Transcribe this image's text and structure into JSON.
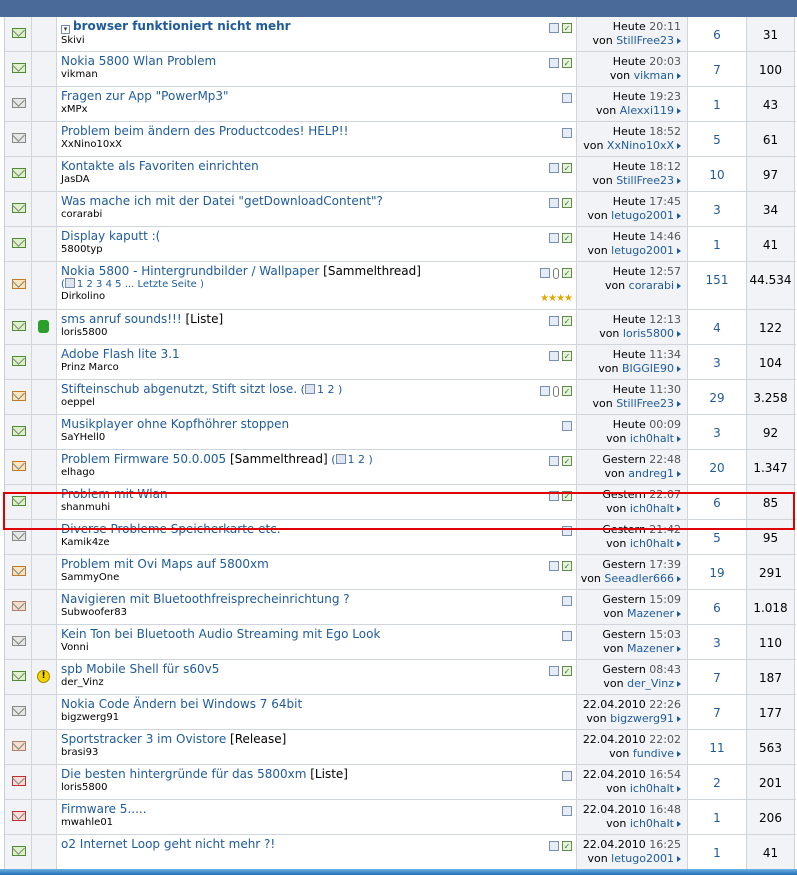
{
  "colors": {
    "link": "#1f5b9b",
    "highlight": "#e00000",
    "header": "#4a6a9a"
  },
  "threads": [
    {
      "icon": "envelope-new",
      "post_icon": "",
      "title": "browser funktioniert nicht mehr",
      "bold": true,
      "tag": "",
      "pages": [],
      "author": "Skivi",
      "date": "Heute",
      "time": "20:11",
      "by": "StillFree23",
      "replies": "6",
      "views": "31",
      "ticons": [
        "attach",
        "check"
      ],
      "has_dropdown": true
    },
    {
      "icon": "envelope-new",
      "post_icon": "",
      "title": "Nokia 5800 Wlan Problem",
      "bold": false,
      "tag": "",
      "pages": [],
      "author": "vikman",
      "date": "Heute",
      "time": "20:03",
      "by": "vikman",
      "replies": "7",
      "views": "100",
      "ticons": [
        "attach",
        "check"
      ]
    },
    {
      "icon": "envelope-grey",
      "post_icon": "",
      "title": "Fragen zur App \"PowerMp3\"",
      "bold": false,
      "tag": "",
      "pages": [],
      "author": "xMPx",
      "date": "Heute",
      "time": "19:23",
      "by": "Alexxi119",
      "replies": "1",
      "views": "43",
      "ticons": [
        "attach"
      ]
    },
    {
      "icon": "envelope-grey",
      "post_icon": "",
      "title": "Problem beim ändern des Productcodes! HELP!!",
      "bold": false,
      "tag": "",
      "pages": [],
      "author": "XxNino10xX",
      "date": "Heute",
      "time": "18:52",
      "by": "XxNino10xX",
      "replies": "5",
      "views": "61",
      "ticons": [
        "attach"
      ]
    },
    {
      "icon": "envelope-new",
      "post_icon": "",
      "title": "Kontakte als Favoriten einrichten",
      "bold": false,
      "tag": "",
      "pages": [],
      "author": "JasDA",
      "date": "Heute",
      "time": "18:12",
      "by": "StillFree23",
      "replies": "10",
      "views": "97",
      "ticons": [
        "attach",
        "check"
      ]
    },
    {
      "icon": "envelope-new",
      "post_icon": "",
      "title": "Was mache ich mit der Datei \"getDownloadContent\"?",
      "bold": false,
      "tag": "",
      "pages": [],
      "author": "corarabi",
      "date": "Heute",
      "time": "17:45",
      "by": "letugo2001",
      "replies": "3",
      "views": "34",
      "ticons": [
        "attach",
        "check"
      ]
    },
    {
      "icon": "envelope-new",
      "post_icon": "",
      "title": "Display kaputt :(",
      "bold": false,
      "tag": "",
      "pages": [],
      "author": "5800typ",
      "date": "Heute",
      "time": "14:46",
      "by": "letugo2001",
      "replies": "1",
      "views": "41",
      "ticons": [
        "attach",
        "check"
      ]
    },
    {
      "icon": "envelope-hot",
      "post_icon": "",
      "title": "Nokia 5800 - Hintergrundbilder / Wallpaper",
      "bold": false,
      "tag": "[Sammelthread]",
      "pages": [
        "1",
        "2",
        "3",
        "4",
        "5",
        "...",
        "Letzte Seite"
      ],
      "author": "Dirkolino",
      "date": "Heute",
      "time": "12:57",
      "by": "corarabi",
      "replies": "151",
      "views": "44.534",
      "ticons": [
        "attach",
        "clip",
        "check"
      ],
      "stars": "★★★★",
      "tall": true
    },
    {
      "icon": "envelope-new",
      "post_icon": "thumb",
      "title": "sms anruf sounds!!!",
      "bold": false,
      "tag": "[Liste]",
      "pages": [],
      "author": "loris5800",
      "date": "Heute",
      "time": "12:13",
      "by": "loris5800",
      "replies": "4",
      "views": "122",
      "ticons": [
        "attach",
        "check"
      ]
    },
    {
      "icon": "envelope-new",
      "post_icon": "",
      "title": "Adobe Flash lite 3.1",
      "bold": false,
      "tag": "",
      "pages": [],
      "author": "Prinz Marco",
      "date": "Heute",
      "time": "11:34",
      "by": "BIGGIE90",
      "replies": "3",
      "views": "104",
      "ticons": [
        "attach",
        "check"
      ]
    },
    {
      "icon": "envelope-hot",
      "post_icon": "",
      "title": "Stifteinschub abgenutzt, Stift sitzt lose.",
      "bold": false,
      "tag": "",
      "pages": [
        "1",
        "2"
      ],
      "author": "oeppel",
      "date": "Heute",
      "time": "11:30",
      "by": "StillFree23",
      "replies": "29",
      "views": "3.258",
      "ticons": [
        "attach",
        "clip",
        "check"
      ],
      "inline_pages": true
    },
    {
      "icon": "envelope-new",
      "post_icon": "",
      "title": "Musikplayer ohne Kopfhöhrer stoppen",
      "bold": false,
      "tag": "",
      "pages": [],
      "author": "SaYHell0",
      "date": "Heute",
      "time": "00:09",
      "by": "ich0halt",
      "replies": "3",
      "views": "92",
      "ticons": [
        "attach"
      ]
    },
    {
      "icon": "envelope-hot",
      "post_icon": "",
      "title": "Problem Firmware 50.0.005",
      "bold": false,
      "tag": "[Sammelthread]",
      "pages": [
        "1",
        "2"
      ],
      "author": "elhago",
      "date": "Gestern",
      "time": "22:48",
      "by": "andreg1",
      "replies": "20",
      "views": "1.347",
      "ticons": [
        "attach",
        "check"
      ],
      "inline_pages": true
    },
    {
      "icon": "envelope-new",
      "post_icon": "",
      "title": "Problem mit Wlan",
      "bold": false,
      "tag": "",
      "pages": [],
      "author": "shanmuhi",
      "date": "Gestern",
      "time": "22:07",
      "by": "ich0halt",
      "replies": "6",
      "views": "85",
      "ticons": [
        "attach",
        "check"
      ]
    },
    {
      "icon": "envelope-grey",
      "post_icon": "",
      "title": "Diverse Probleme Speicherkarte etc.",
      "bold": false,
      "tag": "",
      "pages": [],
      "author": "Kamik4ze",
      "date": "Gestern",
      "time": "21:42",
      "by": "ich0halt",
      "replies": "5",
      "views": "95",
      "ticons": [
        "attach"
      ]
    },
    {
      "icon": "envelope-hot",
      "post_icon": "",
      "title": "Problem mit Ovi Maps auf 5800xm",
      "bold": false,
      "tag": "",
      "pages": [],
      "author": "SammyOne",
      "date": "Gestern",
      "time": "17:39",
      "by": "Seeadler666",
      "replies": "19",
      "views": "291",
      "ticons": [
        "attach",
        "check"
      ]
    },
    {
      "icon": "envelope-hotgrey",
      "post_icon": "",
      "title": "Navigieren mit Bluetoothfreisprecheinrichtung ?",
      "bold": false,
      "tag": "",
      "pages": [],
      "author": "Subwoofer83",
      "date": "Gestern",
      "time": "15:09",
      "by": "Mazener",
      "replies": "6",
      "views": "1.018",
      "ticons": [
        "attach"
      ]
    },
    {
      "icon": "envelope-grey",
      "post_icon": "",
      "title": "Kein Ton bei Bluetooth Audio Streaming mit Ego Look",
      "bold": false,
      "tag": "",
      "pages": [],
      "author": "Vonni",
      "date": "Gestern",
      "time": "15:03",
      "by": "Mazener",
      "replies": "3",
      "views": "110",
      "ticons": [
        "attach"
      ]
    },
    {
      "icon": "envelope-new",
      "post_icon": "warn",
      "title": "spb Mobile Shell für s60v5",
      "bold": false,
      "tag": "",
      "pages": [],
      "author": "der_Vinz",
      "date": "Gestern",
      "time": "08:43",
      "by": "der_Vinz",
      "replies": "7",
      "views": "187",
      "ticons": [
        "attach",
        "check"
      ]
    },
    {
      "icon": "envelope-grey",
      "post_icon": "",
      "title": "Nokia Code Ändern bei Windows 7 64bit",
      "bold": false,
      "tag": "",
      "pages": [],
      "author": "bigzwerg91",
      "date": "22.04.2010",
      "time": "22:26",
      "by": "bigzwerg91",
      "replies": "7",
      "views": "177",
      "ticons": []
    },
    {
      "icon": "envelope-hotgrey",
      "post_icon": "",
      "title": "Sportstracker 3 im Ovistore",
      "bold": false,
      "tag": "[Release]",
      "pages": [],
      "author": "brasi93",
      "date": "22.04.2010",
      "time": "22:02",
      "by": "fundive",
      "replies": "11",
      "views": "563",
      "ticons": []
    },
    {
      "icon": "envelope-locked",
      "post_icon": "",
      "title": "Die besten hintergründe für das 5800xm",
      "bold": false,
      "tag": "[Liste]",
      "pages": [],
      "author": "loris5800",
      "date": "22.04.2010",
      "time": "16:54",
      "by": "ich0halt",
      "replies": "2",
      "views": "201",
      "ticons": [
        "attach"
      ]
    },
    {
      "icon": "envelope-locked",
      "post_icon": "",
      "title": "Firmware 5.....",
      "bold": false,
      "tag": "",
      "pages": [],
      "author": "mwahle01",
      "date": "22.04.2010",
      "time": "16:48",
      "by": "ich0halt",
      "replies": "1",
      "views": "206",
      "ticons": [
        "attach"
      ]
    },
    {
      "icon": "envelope-new",
      "post_icon": "",
      "title": "o2 Internet Loop geht nicht mehr ?!",
      "bold": false,
      "tag": "",
      "pages": [],
      "author": "",
      "date": "22.04.2010",
      "time": "16:25",
      "by": "letugo2001",
      "replies": "1",
      "views": "41",
      "ticons": [
        "attach",
        "check"
      ]
    }
  ],
  "labels": {
    "von": "von"
  }
}
